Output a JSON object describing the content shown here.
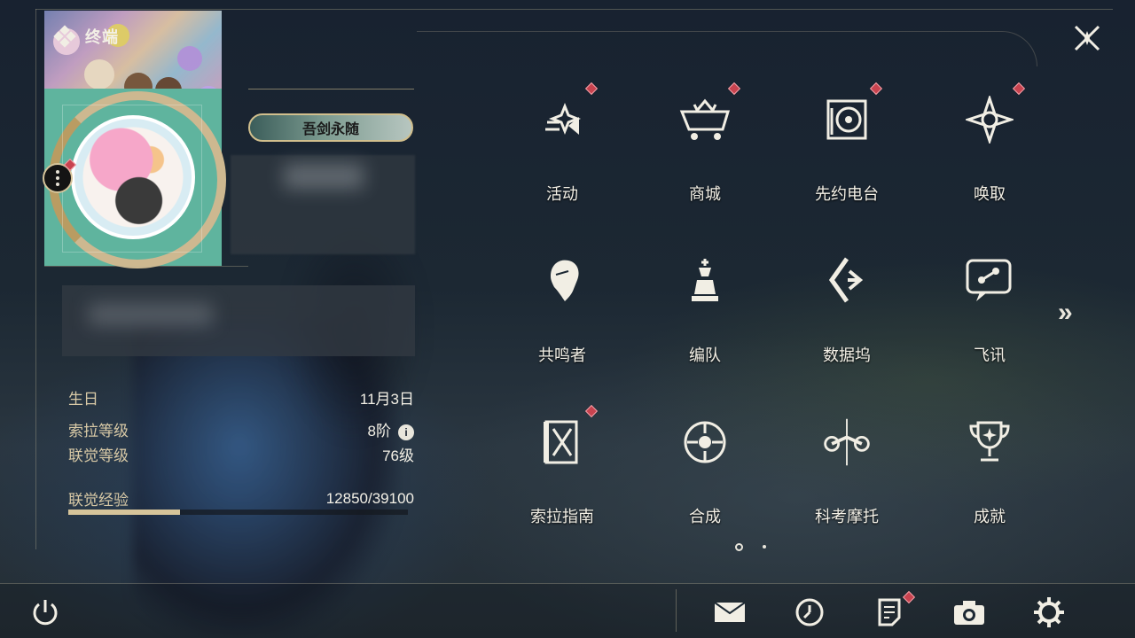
{
  "title": "终端",
  "profile": {
    "nameplate": "吾剑永随"
  },
  "info": {
    "birthday_label": "生日",
    "birthday_value": "11月3日",
    "sola_level_label": "索拉等级",
    "sola_level_value": "8阶",
    "info_icon": "i",
    "union_level_label": "联觉等级",
    "union_level_value": "76级",
    "union_exp_label": "联觉经验",
    "union_exp_value": "12850/39100",
    "union_exp_progress": 0.3286
  },
  "menu": [
    {
      "label": "活动",
      "icon": "events-icon",
      "badge": true
    },
    {
      "label": "商城",
      "icon": "shop-cart-icon",
      "badge": true
    },
    {
      "label": "先约电台",
      "icon": "radio-icon",
      "badge": true
    },
    {
      "label": "唤取",
      "icon": "convene-icon",
      "badge": true
    },
    {
      "label": "共鸣者",
      "icon": "resonator-icon",
      "badge": false
    },
    {
      "label": "编队",
      "icon": "team-chess-icon",
      "badge": false
    },
    {
      "label": "数据坞",
      "icon": "data-bank-icon",
      "badge": false
    },
    {
      "label": "飞讯",
      "icon": "message-chat-icon",
      "badge": false
    },
    {
      "label": "索拉指南",
      "icon": "guidebook-icon",
      "badge": true
    },
    {
      "label": "合成",
      "icon": "synthesis-icon",
      "badge": false
    },
    {
      "label": "科考摩托",
      "icon": "motorbike-icon",
      "badge": false
    },
    {
      "label": "成就",
      "icon": "trophy-icon",
      "badge": false
    }
  ],
  "pagination": {
    "current": 1,
    "total": 2
  },
  "next_arrow": "»",
  "bottom_bar": [
    "power-icon",
    "mail-icon",
    "clock-icon",
    "notice-icon",
    "camera-icon",
    "settings-gear-icon"
  ],
  "colors": {
    "accent": "#d6c49a",
    "badge": "#c8434f",
    "text": "#f3f0e6"
  }
}
